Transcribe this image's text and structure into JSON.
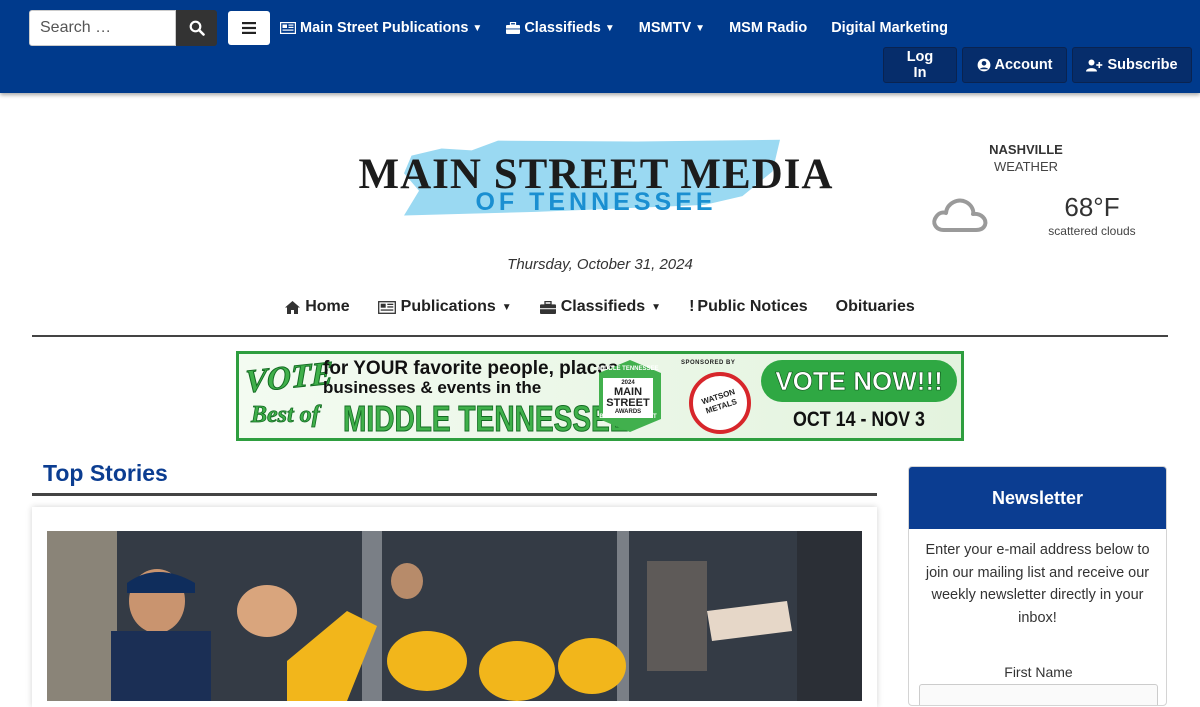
{
  "header": {
    "search": {
      "placeholder": "Search …",
      "icon": "search-icon"
    },
    "menu_icon": "hamburger-icon",
    "nav": [
      {
        "label": "Main Street Publications",
        "icon": "newspaper-icon",
        "dropdown": true
      },
      {
        "label": "Classifieds",
        "icon": "briefcase-icon",
        "dropdown": true
      },
      {
        "label": "MSMTV",
        "dropdown": true
      },
      {
        "label": "MSM Radio"
      },
      {
        "label": "Digital Marketing"
      }
    ],
    "account_buttons": [
      {
        "label": "Log In"
      },
      {
        "label": "Account",
        "icon": "user-circle-icon"
      },
      {
        "label": "Subscribe",
        "icon": "user-plus-icon"
      }
    ],
    "colors": {
      "bar": "#003a8c",
      "button": "#062d6b"
    }
  },
  "masthead": {
    "logo_main": "MAIN STREET MEDIA",
    "logo_sub": "OF TENNESSEE",
    "date": "Thursday, October 31, 2024"
  },
  "weather": {
    "city": "NASHVILLE",
    "label": "WEATHER",
    "temp": "68°F",
    "description": "scattered clouds",
    "icon": "cloud-icon"
  },
  "main_nav": [
    {
      "label": "Home",
      "icon": "home-icon"
    },
    {
      "label": "Publications",
      "icon": "newspaper-icon",
      "dropdown": true
    },
    {
      "label": "Classifieds",
      "icon": "briefcase-icon",
      "dropdown": true
    },
    {
      "label": "Public Notices",
      "icon": "exclamation-icon"
    },
    {
      "label": "Obituaries"
    }
  ],
  "banner": {
    "vote": "VOTE",
    "line1": "for YOUR favorite people, places,",
    "line2": "businesses & events in the",
    "best_of": "Best of",
    "region": "MIDDLE TENNESSEE",
    "award_top": "MIDDLE TENNESSEE",
    "award_year": "2024",
    "award_name": "MAIN STREET",
    "award_sub": "AWARDS",
    "award_best": "BEST OF THE BEST",
    "sponsored": "SPONSORED BY",
    "sponsor": "WATSON METALS",
    "cta": "VOTE NOW!!!",
    "dates": "OCT 14 - NOV 3"
  },
  "top_stories": {
    "title": "Top Stories"
  },
  "newsletter": {
    "title": "Newsletter",
    "text": "Enter your e-mail address below to join our mailing list and receive our weekly newsletter directly in your inbox!",
    "first_name_label": "First Name"
  }
}
